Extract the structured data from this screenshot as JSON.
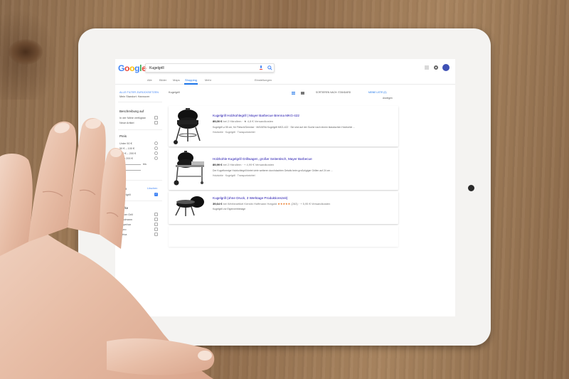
{
  "search": {
    "logo": [
      "G",
      "o",
      "o",
      "g",
      "l",
      "e"
    ],
    "query": "Kugelgrill"
  },
  "tabs": [
    {
      "label": "Alle"
    },
    {
      "label": "Bilder"
    },
    {
      "label": "Maps"
    },
    {
      "label": "Shopping"
    },
    {
      "label": "Mehr"
    },
    {
      "label": "Einstellungen"
    }
  ],
  "sidebar": {
    "reset": "ALLE FILTER ZURÜCKSETZEN",
    "location": "Mein Standort: Hannover",
    "description_heading": "Beschreibung auf",
    "description_options": [
      "In der Nähe verfügbar",
      "Neue Artikel"
    ],
    "price_heading": "Preis",
    "price_options": [
      "Unter 50 €",
      "50 € – 100 €",
      "100 € – 200 €",
      "Über 200 €"
    ],
    "price_separator": "bis",
    "price_apply": "Los",
    "type_heading": "Form",
    "type_link": "Löschen",
    "type_option": "Kugelgrill",
    "brand_heading": "Marke",
    "brand_options": [
      "Weber Grill",
      "Landmann",
      "Mayerbar",
      "Tepro",
      "Activa"
    ]
  },
  "results": {
    "label": "Kugelgrill",
    "sort_label": "SORTIEREN NACH: STANDARD",
    "list_label": "MEINE LISTE (0)",
    "anzeigen": "Anzeigen",
    "items": [
      {
        "title": "Kugelgrill Holzkohlegrill | Mayer Barbecue Brenna MKG-422",
        "price": "89,00 €",
        "price_note": "bei 2 Händlern · ★ 4,8 € Versandkosten",
        "desc": "Kugelgrill ⌀ 55 cm, für Fleisch/Gemüse · MAYARIA Kugelgrill MKG-422 · Sie sind auf der Suche nach einem klassischen Holzkohle ...",
        "tags": "Holzkohle · Kugelgrill · Transportwichtel"
      },
      {
        "title": "Holzkohle-Kugelgrill Grillwagen, großer Seitentisch, Mayer Barbecue",
        "price": "89,99 €",
        "price_note": "bei 2 Händlern · + 4,99 € Versandkosten",
        "desc": "Der Kugelformige Holzkohlegrill bietet viele weiteren durchdachten Details beim großzügiger Grillen auf 24 cm ...",
        "tags": "Holzkohle · Kugelgrill · Transportwichtel"
      },
      {
        "title": "Kugelgrill (ohne Druck, 3 Werktage Produktionszeit)",
        "price": "39,64 €",
        "price_note": "bei Werbeartikel Kerstin Hoffmann Hotgold",
        "stars": "★★★★★",
        "rating_note": "(263) · + 5,95 € Versandkosten",
        "desc": "Kugelgrill vor Eigenvertriebage",
        "tags": ""
      }
    ]
  },
  "colors": {
    "link": "#1a0dab",
    "accent": "#4285f4",
    "active_tab": "#1a73e8"
  }
}
